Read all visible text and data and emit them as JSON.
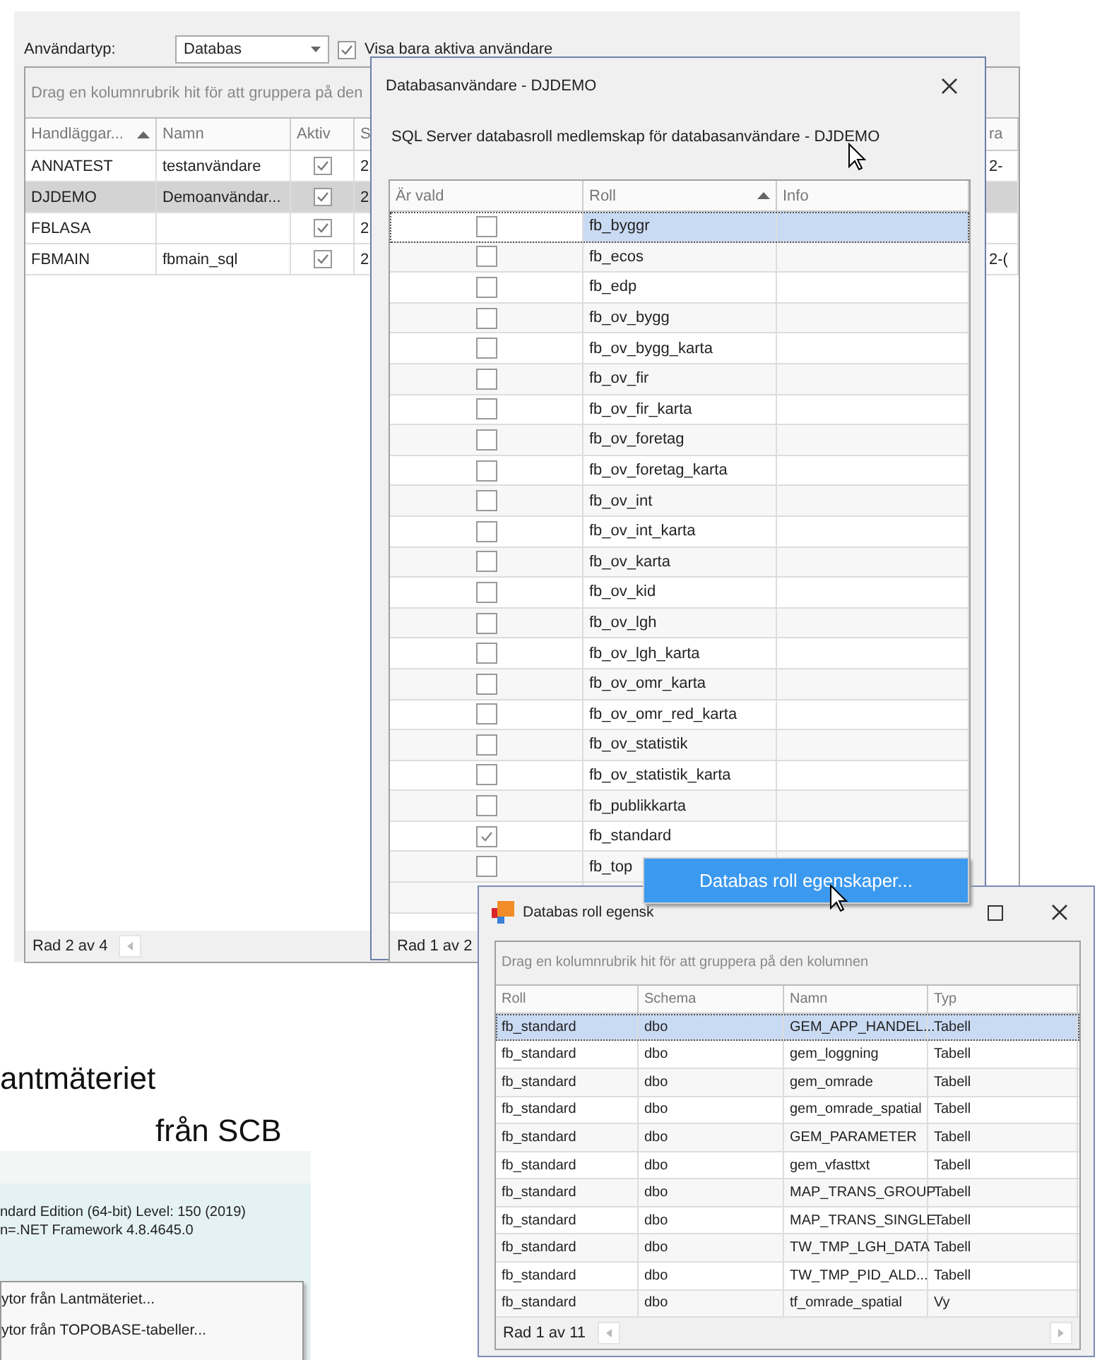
{
  "main_window": {
    "filter_label": "Användartyp:",
    "type_combo": {
      "value": "Databas"
    },
    "active_only": {
      "checked": true,
      "label": "Visa bara aktiva användare"
    },
    "group_panel": "Drag en kolumnrubrik hit för att gruppera på den",
    "columns": [
      {
        "label": "Handläggar...",
        "sorted": true
      },
      {
        "label": "Namn",
        "sorted": false
      },
      {
        "label": "Aktiv",
        "sorted": false
      },
      {
        "label": "S"
      },
      {
        "label": "ra"
      }
    ],
    "rows": [
      {
        "handlaggare": "ANNATEST",
        "namn": "testanvändare",
        "active": true,
        "column_4": "2",
        "column_5": "2-",
        "selected": false
      },
      {
        "handlaggare": "DJDEMO",
        "namn": "Demoanvändar...",
        "active": true,
        "column_4": "2",
        "selected": true
      },
      {
        "handlaggare": "FBLASA",
        "active": true,
        "column_4": "2",
        "selected": false
      },
      {
        "handlaggare": "FBMAIN",
        "namn": "fbmain_sql",
        "active": true,
        "column_4": "2",
        "column_5": "2-(",
        "selected": false
      }
    ],
    "footer": "Rad 2 av 4"
  },
  "slide_text": [
    "antmäteriet",
    "från SCB"
  ],
  "info_panel": {
    "lines": [
      "ndard Edition (64-bit) Level: 150 (2019)",
      "n=.NET Framework 4.8.4645.0"
    ],
    "menu_items": [
      "ytor från Lantmäteriet...",
      "ytor från TOPOBASE-tabeller..."
    ]
  },
  "dialog": {
    "title": "Databasanvändare - DJDEMO",
    "heading": "SQL Server databasroll medlemskap för databasanvändare - DJDEMO",
    "columns": [
      {
        "label": "Är vald",
        "sorted": false
      },
      {
        "label": "Roll",
        "sorted": true
      },
      {
        "label": "Info",
        "sorted": false
      }
    ],
    "rows": [
      {
        "roll": "fb_byggr",
        "checked": false,
        "selected": true
      },
      {
        "roll": "fb_ecos",
        "checked": false,
        "selected": false
      },
      {
        "roll": "fb_edp",
        "checked": false,
        "selected": false
      },
      {
        "roll": "fb_ov_bygg",
        "checked": false,
        "selected": false
      },
      {
        "roll": "fb_ov_bygg_karta",
        "checked": false,
        "selected": false
      },
      {
        "roll": "fb_ov_fir",
        "checked": false,
        "selected": false
      },
      {
        "roll": "fb_ov_fir_karta",
        "checked": false,
        "selected": false
      },
      {
        "roll": "fb_ov_foretag",
        "checked": false,
        "selected": false
      },
      {
        "roll": "fb_ov_foretag_karta",
        "checked": false,
        "selected": false
      },
      {
        "roll": "fb_ov_int",
        "checked": false,
        "selected": false
      },
      {
        "roll": "fb_ov_int_karta",
        "checked": false,
        "selected": false
      },
      {
        "roll": "fb_ov_karta",
        "checked": false,
        "selected": false
      },
      {
        "roll": "fb_ov_kid",
        "checked": false,
        "selected": false
      },
      {
        "roll": "fb_ov_lgh",
        "checked": false,
        "selected": false
      },
      {
        "roll": "fb_ov_lgh_karta",
        "checked": false,
        "selected": false
      },
      {
        "roll": "fb_ov_omr_karta",
        "checked": false,
        "selected": false
      },
      {
        "roll": "fb_ov_omr_red_karta",
        "checked": false,
        "selected": false
      },
      {
        "roll": "fb_ov_statistik",
        "checked": false,
        "selected": false
      },
      {
        "roll": "fb_ov_statistik_karta",
        "checked": false,
        "selected": false
      },
      {
        "roll": "fb_publikkarta",
        "checked": false,
        "selected": false
      },
      {
        "roll": "fb_standard",
        "checked": true,
        "selected": false
      },
      {
        "roll": "fb_top",
        "checked": false,
        "selected": false
      }
    ],
    "footer": "Rad 1 av 2"
  },
  "context_menu": {
    "items": [
      "Databas roll egenskaper..."
    ]
  },
  "properties_window": {
    "title": "Databas roll egensk",
    "group_panel": "Drag en kolumnrubrik hit för att gruppera på den kolumnen",
    "columns": [
      "Roll",
      "Schema",
      "Namn",
      "Typ"
    ],
    "rows": [
      {
        "cells": [
          "fb_standard",
          "dbo",
          "GEM_APP_HANDEL...",
          "Tabell"
        ],
        "selected": true
      },
      {
        "cells": [
          "fb_standard",
          "dbo",
          "gem_loggning",
          "Tabell"
        ],
        "selected": false
      },
      {
        "cells": [
          "fb_standard",
          "dbo",
          "gem_omrade",
          "Tabell"
        ],
        "selected": false
      },
      {
        "cells": [
          "fb_standard",
          "dbo",
          "gem_omrade_spatial",
          "Tabell"
        ],
        "selected": false
      },
      {
        "cells": [
          "fb_standard",
          "dbo",
          "GEM_PARAMETER",
          "Tabell"
        ],
        "selected": false
      },
      {
        "cells": [
          "fb_standard",
          "dbo",
          "gem_vfasttxt",
          "Tabell"
        ],
        "selected": false
      },
      {
        "cells": [
          "fb_standard",
          "dbo",
          "MAP_TRANS_GROUP",
          "Tabell"
        ],
        "selected": false
      },
      {
        "cells": [
          "fb_standard",
          "dbo",
          "MAP_TRANS_SINGLE",
          "Tabell"
        ],
        "selected": false
      },
      {
        "cells": [
          "fb_standard",
          "dbo",
          "TW_TMP_LGH_DATA",
          "Tabell"
        ],
        "selected": false
      },
      {
        "cells": [
          "fb_standard",
          "dbo",
          "TW_TMP_PID_ALD...",
          "Tabell"
        ],
        "selected": false
      },
      {
        "cells": [
          "fb_standard",
          "dbo",
          "tf_omrade_spatial",
          "Vy"
        ],
        "selected": false
      }
    ],
    "footer": "Rad 1 av 11"
  }
}
